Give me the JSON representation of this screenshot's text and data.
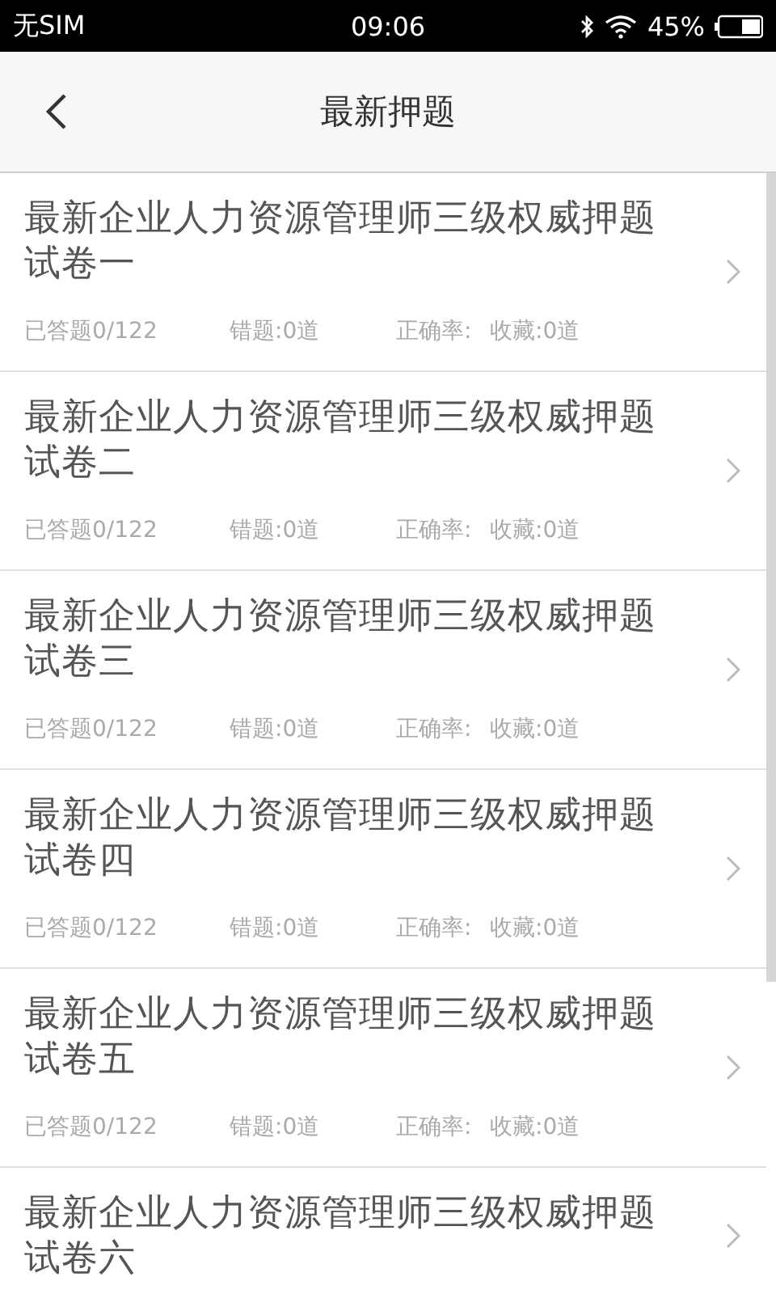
{
  "status_bar": {
    "carrier": "无SIM",
    "time": "09:06",
    "battery": "45%"
  },
  "nav": {
    "title": "最新押题"
  },
  "papers": [
    {
      "title": "最新企业人力资源管理师三级权威押题试卷一",
      "stats": [
        "已答题0/122",
        "错题:0道",
        "正确率:",
        "收藏:0道"
      ]
    },
    {
      "title": "最新企业人力资源管理师三级权威押题试卷二",
      "stats": [
        "已答题0/122",
        "错题:0道",
        "正确率:",
        "收藏:0道"
      ]
    },
    {
      "title": "最新企业人力资源管理师三级权威押题试卷三",
      "stats": [
        "已答题0/122",
        "错题:0道",
        "正确率:",
        "收藏:0道"
      ]
    },
    {
      "title": "最新企业人力资源管理师三级权威押题试卷四",
      "stats": [
        "已答题0/122",
        "错题:0道",
        "正确率:",
        "收藏:0道"
      ]
    },
    {
      "title": "最新企业人力资源管理师三级权威押题试卷五",
      "stats": [
        "已答题0/122",
        "错题:0道",
        "正确率:",
        "收藏:0道"
      ]
    },
    {
      "title": "最新企业人力资源管理师三级权威押题试卷六"
    }
  ]
}
